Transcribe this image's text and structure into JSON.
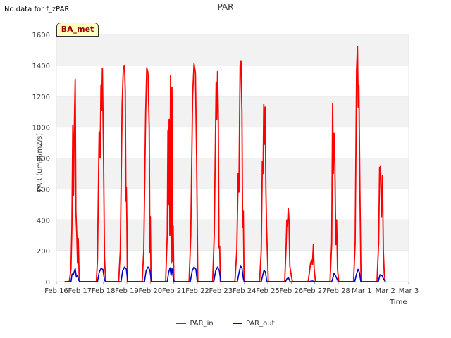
{
  "header": {
    "note": "No data for f_zPAR",
    "badge": "BA_met"
  },
  "chart_data": {
    "type": "line",
    "title": "PAR",
    "xlabel": "Time",
    "ylabel": "PAR (umol/m2/s)",
    "ylim": [
      0,
      1600
    ],
    "yticks": [
      0,
      200,
      400,
      600,
      800,
      1000,
      1200,
      1400,
      1600
    ],
    "xlim": [
      0,
      15
    ],
    "xtick_labels": [
      "Feb 16",
      "Feb 17",
      "Feb 18",
      "Feb 19",
      "Feb 20",
      "Feb 21",
      "Feb 22",
      "Feb 23",
      "Feb 24",
      "Feb 25",
      "Feb 26",
      "Feb 27",
      "Feb 28",
      "Mar 1",
      "Mar 2",
      "Mar 3"
    ],
    "grid": true,
    "legend_position": "bottom",
    "series": [
      {
        "name": "PAR_in",
        "color": "#ff0000",
        "peaks": [
          1310,
          1380,
          1400,
          1390,
          1335,
          1410,
          1365,
          1430,
          1150,
          475,
          240,
          1155,
          1520,
          745
        ],
        "points": [
          [
            0.35,
            0
          ],
          [
            0.55,
            0
          ],
          [
            0.62,
            80
          ],
          [
            0.66,
            350
          ],
          [
            0.7,
            1010
          ],
          [
            0.73,
            560
          ],
          [
            0.76,
            960
          ],
          [
            0.8,
            1310
          ],
          [
            0.83,
            450
          ],
          [
            0.87,
            300
          ],
          [
            0.9,
            120
          ],
          [
            0.93,
            280
          ],
          [
            0.97,
            40
          ],
          [
            1.0,
            0
          ],
          [
            1.7,
            0
          ],
          [
            1.75,
            140
          ],
          [
            1.82,
            970
          ],
          [
            1.86,
            800
          ],
          [
            1.9,
            1270
          ],
          [
            1.93,
            1110
          ],
          [
            1.96,
            1380
          ],
          [
            2.0,
            900
          ],
          [
            2.05,
            150
          ],
          [
            2.1,
            0
          ],
          [
            2.65,
            0
          ],
          [
            2.72,
            200
          ],
          [
            2.8,
            1150
          ],
          [
            2.85,
            1380
          ],
          [
            2.9,
            1400
          ],
          [
            2.93,
            1240
          ],
          [
            2.96,
            520
          ],
          [
            2.98,
            610
          ],
          [
            3.0,
            400
          ],
          [
            3.02,
            0
          ],
          [
            3.65,
            0
          ],
          [
            3.72,
            200
          ],
          [
            3.8,
            1100
          ],
          [
            3.85,
            1385
          ],
          [
            3.9,
            1350
          ],
          [
            3.95,
            1000
          ],
          [
            3.98,
            190
          ],
          [
            4.0,
            420
          ],
          [
            4.03,
            0
          ],
          [
            4.65,
            0
          ],
          [
            4.72,
            300
          ],
          [
            4.75,
            980
          ],
          [
            4.78,
            500
          ],
          [
            4.8,
            1050
          ],
          [
            4.83,
            300
          ],
          [
            4.86,
            1335
          ],
          [
            4.89,
            120
          ],
          [
            4.92,
            1260
          ],
          [
            4.95,
            130
          ],
          [
            4.97,
            360
          ],
          [
            5.0,
            0
          ],
          [
            5.65,
            0
          ],
          [
            5.72,
            300
          ],
          [
            5.8,
            1200
          ],
          [
            5.86,
            1410
          ],
          [
            5.92,
            1350
          ],
          [
            5.97,
            800
          ],
          [
            6.02,
            0
          ],
          [
            6.65,
            0
          ],
          [
            6.72,
            300
          ],
          [
            6.77,
            920
          ],
          [
            6.8,
            1290
          ],
          [
            6.83,
            1050
          ],
          [
            6.86,
            1360
          ],
          [
            6.89,
            1100
          ],
          [
            6.92,
            220
          ],
          [
            6.95,
            230
          ],
          [
            6.98,
            0
          ],
          [
            7.6,
            0
          ],
          [
            7.68,
            200
          ],
          [
            7.74,
            700
          ],
          [
            7.77,
            580
          ],
          [
            7.82,
            1400
          ],
          [
            7.86,
            1430
          ],
          [
            7.9,
            1100
          ],
          [
            7.93,
            350
          ],
          [
            7.96,
            460
          ],
          [
            7.99,
            0
          ],
          [
            8.65,
            0
          ],
          [
            8.72,
            200
          ],
          [
            8.77,
            780
          ],
          [
            8.8,
            700
          ],
          [
            8.83,
            1150
          ],
          [
            8.86,
            890
          ],
          [
            8.89,
            1130
          ],
          [
            8.92,
            600
          ],
          [
            8.95,
            350
          ],
          [
            8.98,
            200
          ],
          [
            9.02,
            0
          ],
          [
            9.72,
            0
          ],
          [
            9.78,
            230
          ],
          [
            9.81,
            400
          ],
          [
            9.84,
            360
          ],
          [
            9.87,
            475
          ],
          [
            9.9,
            410
          ],
          [
            9.94,
            100
          ],
          [
            10.0,
            40
          ],
          [
            10.05,
            0
          ],
          [
            10.72,
            0
          ],
          [
            10.78,
            70
          ],
          [
            10.82,
            120
          ],
          [
            10.86,
            140
          ],
          [
            10.9,
            110
          ],
          [
            10.94,
            240
          ],
          [
            10.97,
            90
          ],
          [
            11.0,
            40
          ],
          [
            11.03,
            0
          ],
          [
            11.65,
            0
          ],
          [
            11.72,
            250
          ],
          [
            11.76,
            1155
          ],
          [
            11.79,
            700
          ],
          [
            11.82,
            960
          ],
          [
            11.85,
            850
          ],
          [
            11.88,
            450
          ],
          [
            11.9,
            240
          ],
          [
            11.93,
            400
          ],
          [
            11.97,
            80
          ],
          [
            12.02,
            0
          ],
          [
            12.65,
            0
          ],
          [
            12.72,
            250
          ],
          [
            12.78,
            1370
          ],
          [
            12.82,
            1520
          ],
          [
            12.85,
            1130
          ],
          [
            12.88,
            1270
          ],
          [
            12.92,
            600
          ],
          [
            12.97,
            0
          ],
          [
            13.65,
            0
          ],
          [
            13.72,
            250
          ],
          [
            13.76,
            740
          ],
          [
            13.8,
            745
          ],
          [
            13.84,
            420
          ],
          [
            13.88,
            690
          ],
          [
            13.92,
            200
          ],
          [
            13.96,
            50
          ],
          [
            14.0,
            0
          ]
        ]
      },
      {
        "name": "PAR_out",
        "color": "#0000cc",
        "peaks": [
          85,
          85,
          95,
          95,
          90,
          95,
          95,
          100,
          75,
          25,
          5,
          55,
          80,
          45
        ],
        "points": [
          [
            0.35,
            0
          ],
          [
            0.62,
            0
          ],
          [
            0.67,
            50
          ],
          [
            0.72,
            45
          ],
          [
            0.8,
            85
          ],
          [
            0.85,
            30
          ],
          [
            0.9,
            40
          ],
          [
            0.95,
            10
          ],
          [
            1.0,
            0
          ],
          [
            1.75,
            0
          ],
          [
            1.82,
            60
          ],
          [
            1.9,
            85
          ],
          [
            1.98,
            80
          ],
          [
            2.05,
            10
          ],
          [
            2.1,
            0
          ],
          [
            2.75,
            0
          ],
          [
            2.82,
            70
          ],
          [
            2.9,
            95
          ],
          [
            2.98,
            80
          ],
          [
            3.04,
            0
          ],
          [
            3.75,
            0
          ],
          [
            3.82,
            70
          ],
          [
            3.9,
            95
          ],
          [
            3.98,
            75
          ],
          [
            4.04,
            0
          ],
          [
            4.72,
            0
          ],
          [
            4.78,
            60
          ],
          [
            4.84,
            90
          ],
          [
            4.88,
            40
          ],
          [
            4.92,
            85
          ],
          [
            4.98,
            20
          ],
          [
            5.02,
            0
          ],
          [
            5.7,
            0
          ],
          [
            5.78,
            70
          ],
          [
            5.86,
            95
          ],
          [
            5.94,
            80
          ],
          [
            6.0,
            0
          ],
          [
            6.7,
            0
          ],
          [
            6.78,
            70
          ],
          [
            6.86,
            95
          ],
          [
            6.94,
            70
          ],
          [
            7.0,
            0
          ],
          [
            7.7,
            0
          ],
          [
            7.78,
            60
          ],
          [
            7.84,
            100
          ],
          [
            7.9,
            90
          ],
          [
            7.96,
            20
          ],
          [
            8.0,
            0
          ],
          [
            8.72,
            0
          ],
          [
            8.78,
            40
          ],
          [
            8.84,
            75
          ],
          [
            8.9,
            60
          ],
          [
            8.96,
            0
          ],
          [
            9.75,
            0
          ],
          [
            9.82,
            20
          ],
          [
            9.88,
            25
          ],
          [
            9.95,
            0
          ],
          [
            10.75,
            0
          ],
          [
            10.9,
            5
          ],
          [
            11.0,
            0
          ],
          [
            11.72,
            0
          ],
          [
            11.78,
            30
          ],
          [
            11.82,
            55
          ],
          [
            11.88,
            40
          ],
          [
            11.94,
            20
          ],
          [
            12.0,
            0
          ],
          [
            12.7,
            0
          ],
          [
            12.78,
            50
          ],
          [
            12.84,
            80
          ],
          [
            12.9,
            60
          ],
          [
            12.96,
            0
          ],
          [
            13.7,
            0
          ],
          [
            13.78,
            45
          ],
          [
            13.86,
            40
          ],
          [
            13.92,
            20
          ],
          [
            14.0,
            0
          ]
        ]
      }
    ]
  }
}
